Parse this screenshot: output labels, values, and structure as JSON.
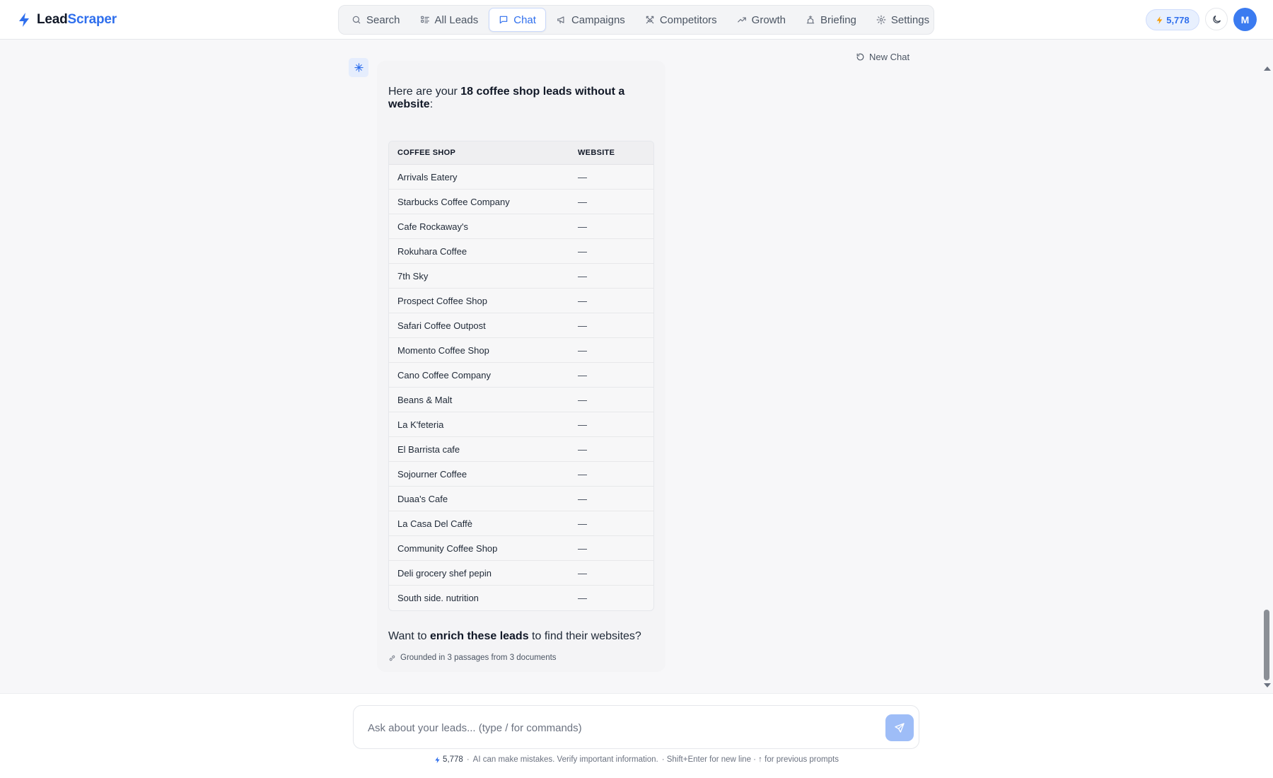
{
  "app": {
    "brand_lead": "Lead",
    "brand_scraper": "Scraper",
    "accent_color": "#2f6fed"
  },
  "nav": {
    "items": [
      {
        "label": "Search",
        "icon": "search-icon"
      },
      {
        "label": "All Leads",
        "icon": "list-icon"
      },
      {
        "label": "Chat",
        "icon": "chat-icon",
        "active": true
      },
      {
        "label": "Campaigns",
        "icon": "megaphone-icon"
      },
      {
        "label": "Competitors",
        "icon": "swords-icon"
      },
      {
        "label": "Growth",
        "icon": "trending-up-icon"
      },
      {
        "label": "Briefing",
        "icon": "briefing-icon"
      },
      {
        "label": "Settings",
        "icon": "gear-icon"
      }
    ]
  },
  "header": {
    "credits": "5,778",
    "avatar_initial": "M"
  },
  "chat": {
    "new_chat_label": "New Chat",
    "message": {
      "intro_prefix": "Here are your ",
      "intro_bold": "18 coffee shop leads without a website",
      "intro_suffix": ":",
      "table": {
        "headers": [
          "COFFEE SHOP",
          "WEBSITE"
        ],
        "rows": [
          [
            "Arrivals Eatery",
            "—"
          ],
          [
            "Starbucks Coffee Company",
            "—"
          ],
          [
            "Cafe Rockaway's",
            "—"
          ],
          [
            "Rokuhara Coffee",
            "—"
          ],
          [
            "7th Sky",
            "—"
          ],
          [
            "Prospect Coffee Shop",
            "—"
          ],
          [
            "Safari Coffee Outpost",
            "—"
          ],
          [
            "Momento Coffee Shop",
            "—"
          ],
          [
            "Cano Coffee Company",
            "—"
          ],
          [
            "Beans & Malt",
            "—"
          ],
          [
            "La K'feteria",
            "—"
          ],
          [
            "El Barrista cafe",
            "—"
          ],
          [
            "Sojourner Coffee",
            "—"
          ],
          [
            "Duaa's Cafe",
            "—"
          ],
          [
            "La Casa Del Caffè",
            "—"
          ],
          [
            "Community Coffee Shop",
            "—"
          ],
          [
            "Deli grocery shef pepin",
            "—"
          ],
          [
            "South side. nutrition",
            "—"
          ]
        ]
      },
      "outro_prefix": "Want to ",
      "outro_bold": "enrich these leads",
      "outro_suffix": " to find their websites?",
      "grounded": "Grounded in 3 passages from 3 documents"
    }
  },
  "composer": {
    "placeholder": "Ask about your leads... (type / for commands)",
    "value": "",
    "footer_credits": "5,778",
    "footer_sep": "·",
    "footer_disclaimer": "AI can make mistakes. Verify important information.",
    "footer_hint": "· Shift+Enter for new line · ↑ for previous prompts"
  }
}
